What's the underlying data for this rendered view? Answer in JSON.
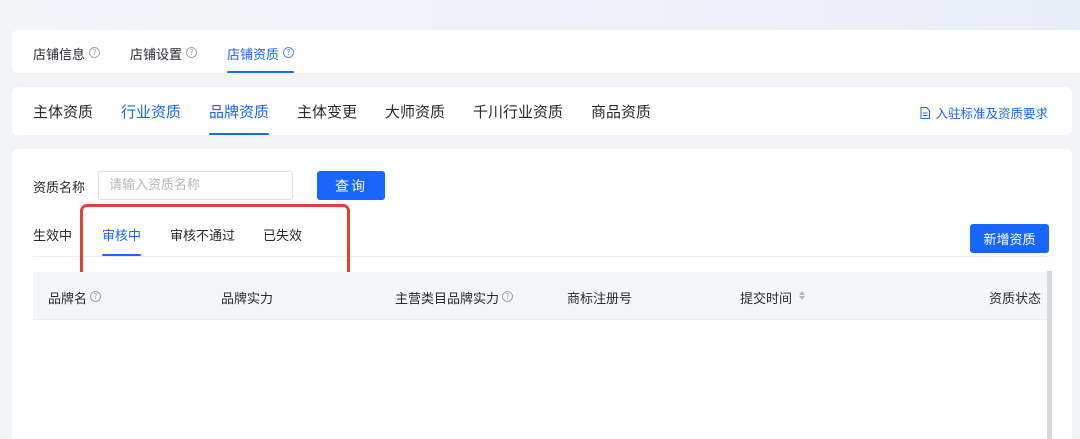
{
  "store_tabs": [
    {
      "label": "店铺信息"
    },
    {
      "label": "店铺设置"
    },
    {
      "label": "店铺资质"
    }
  ],
  "store_tabs_active": "店铺资质",
  "qual_tabs": [
    {
      "label": "主体资质"
    },
    {
      "label": "行业资质"
    },
    {
      "label": "品牌资质"
    },
    {
      "label": "主体变更"
    },
    {
      "label": "大师资质"
    },
    {
      "label": "千川行业资质"
    },
    {
      "label": "商品资质"
    }
  ],
  "qual_tabs_active": "品牌资质",
  "entry_link": "入驻标准及资质要求",
  "search": {
    "label": "资质名称",
    "placeholder": "请输入资质名称",
    "value": "",
    "button": "查询"
  },
  "status_tabs": [
    {
      "label": "生效中"
    },
    {
      "label": "审核中"
    },
    {
      "label": "审核不通过"
    },
    {
      "label": "已失效"
    }
  ],
  "status_tabs_active": "审核中",
  "add_button": "新增资质",
  "table": {
    "columns": [
      "品牌名",
      "品牌实力",
      "主营类目品牌实力",
      "商标注册号",
      "提交时间",
      "资质状态"
    ],
    "rows": []
  },
  "colors": {
    "accent": "#1966ff",
    "highlight": "#e0413a",
    "background": "#f2f4f8"
  }
}
